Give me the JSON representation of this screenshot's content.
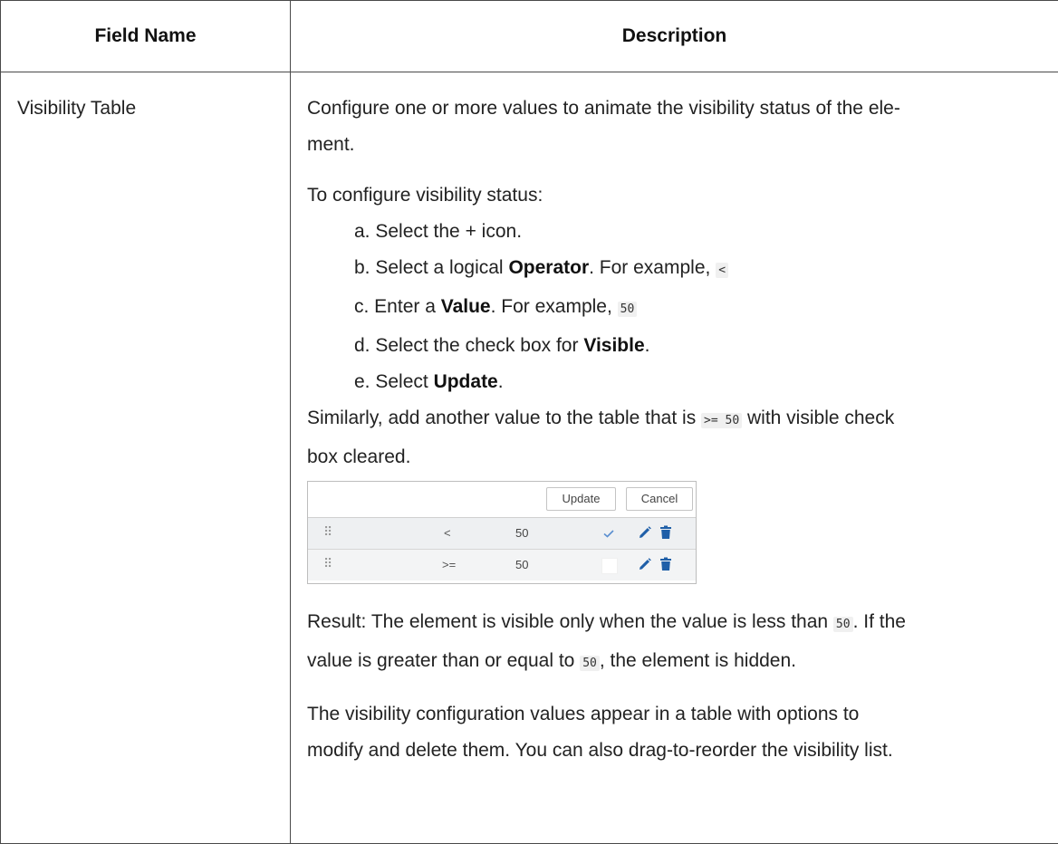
{
  "table": {
    "headers": {
      "field_name": "Field Name",
      "description": "Description"
    },
    "row": {
      "field": "Visibility Table",
      "intro_line": "Configure one or more values to animate the visibility status of the ele-",
      "intro_line2": "ment.",
      "configure_heading": "To configure visibility status:",
      "step_a": "a. Select the + icon.",
      "step_b_prefix": "b. Select a logical ",
      "step_b_bold": "Operator",
      "step_b_suffix": ". For example, ",
      "step_b_code": "<",
      "step_c_prefix": "c. Enter a ",
      "step_c_bold": "Value",
      "step_c_suffix": ". For example, ",
      "step_c_code": "50",
      "step_d_prefix": "d. Select the check box for ",
      "step_d_bold": "Visible",
      "step_d_suffix": ".",
      "step_e_prefix": "e. Select ",
      "step_e_bold": "Update",
      "step_e_suffix": ".",
      "similarly_prefix": "Similarly, add another value to the table that is ",
      "similarly_code": ">= 50",
      "similarly_suffix": " with visible check",
      "similarly_line2": "box cleared.",
      "result_prefix": "Result: The element is visible only when the value is less than ",
      "result_code1": "50",
      "result_mid": ". If the",
      "result_line2_prefix": "value is greater than or equal to ",
      "result_code2": "50",
      "result_line2_suffix": ", the element is hidden.",
      "final_line1": "The visibility configuration values appear in a table with options to",
      "final_line2": "modify and delete them. You can also drag-to-reorder the visibility list."
    }
  },
  "mini_table": {
    "update_label": "Update",
    "cancel_label": "Cancel",
    "rows": [
      {
        "grip": "⠿",
        "operator": "<",
        "value": "50",
        "visible": true
      },
      {
        "grip": "⠿",
        "operator": ">=",
        "value": "50",
        "visible": false
      }
    ],
    "accent_color": "#1f5fa8",
    "icons": [
      "drag-handle-icon",
      "checkmark-icon",
      "edit-pencil-icon",
      "trash-icon"
    ]
  }
}
